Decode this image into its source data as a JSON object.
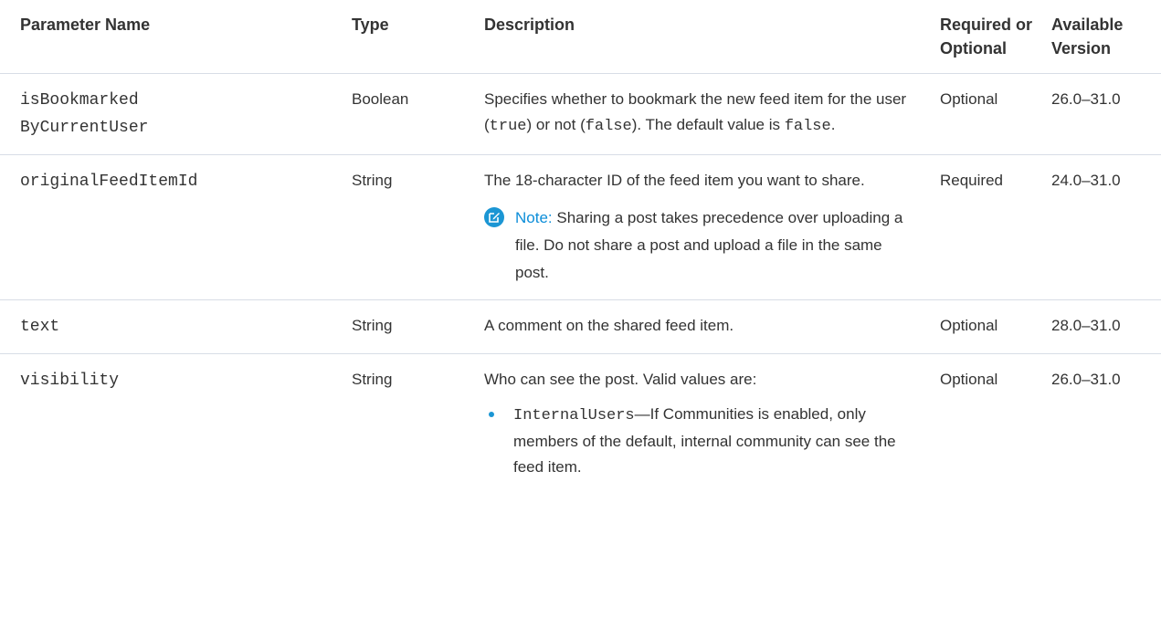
{
  "headers": {
    "name": "Parameter Name",
    "type": "Type",
    "description": "Description",
    "required": "Required or Optional",
    "version": "Available Version"
  },
  "rows": [
    {
      "name_line1": "isBookmarked",
      "name_line2": "ByCurrentUser",
      "type": "Boolean",
      "desc_a": "Specifies whether to bookmark the new feed item for the user (",
      "desc_code1": "true",
      "desc_b": ") or not (",
      "desc_code2": "false",
      "desc_c": "). The default value is ",
      "desc_code3": "false",
      "desc_d": ".",
      "required": "Optional",
      "version": "26.0–31.0"
    },
    {
      "name": "originalFeedItemId",
      "type": "String",
      "desc": "The 18-character ID of the feed item you want to share.",
      "note_label": "Note:",
      "note_text": "Sharing a post takes precedence over uploading a file. Do not share a post and upload a file in the same post.",
      "required": "Required",
      "version": "24.0–31.0"
    },
    {
      "name": "text",
      "type": "String",
      "desc": "A comment on the shared feed item.",
      "required": "Optional",
      "version": "28.0–31.0"
    },
    {
      "name": "visibility",
      "type": "String",
      "desc": "Who can see the post. Valid values are:",
      "bullet_code": "InternalUsers",
      "bullet_text": "—If Communities is enabled, only members of the default, internal community can see the feed item.",
      "required": "Optional",
      "version": "26.0–31.0"
    }
  ],
  "colors": {
    "accent": "#1b96d4",
    "note_label": "#0d8ed9",
    "border": "#d8dde6",
    "text": "#333333"
  },
  "icons": {
    "note": "edit-note-icon",
    "bullet": "bullet-dot-icon"
  }
}
